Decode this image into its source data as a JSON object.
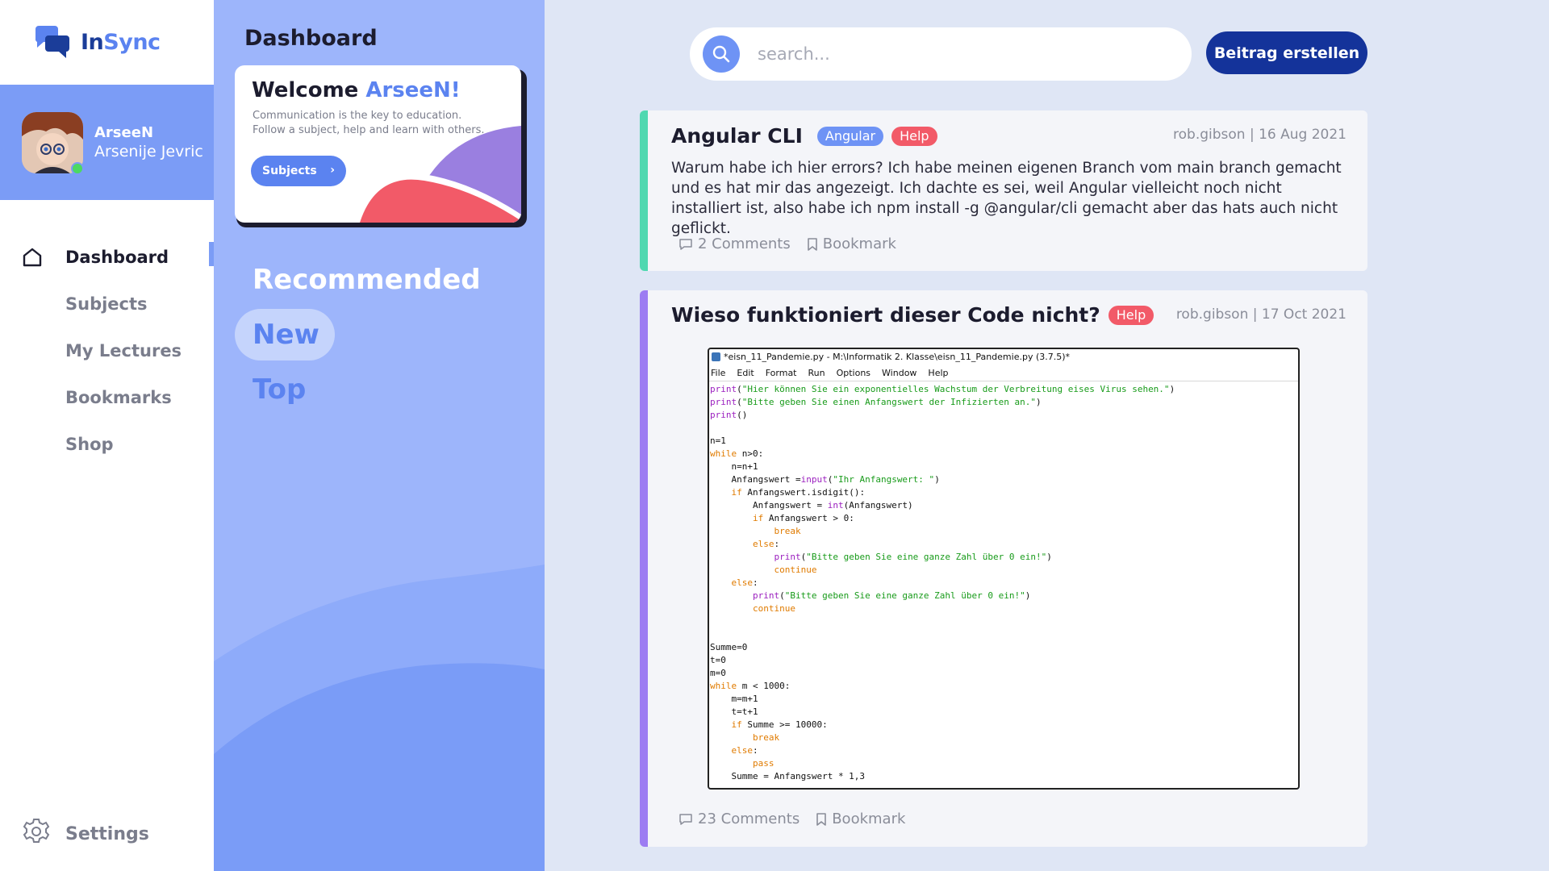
{
  "app": {
    "logo_part1": "In",
    "logo_part2": "Sync"
  },
  "profile": {
    "username": "ArseeN",
    "full_name": "Arsenije Jevric"
  },
  "nav": {
    "items": [
      {
        "label": "Dashboard"
      },
      {
        "label": "Subjects"
      },
      {
        "label": "My Lectures"
      },
      {
        "label": "Bookmarks"
      },
      {
        "label": "Shop"
      }
    ],
    "settings_label": "Settings"
  },
  "dashboard": {
    "title": "Dashboard",
    "welcome_prefix": "Welcome ",
    "welcome_name": "ArseeN!",
    "welcome_line1": "Communication is the key to education.",
    "welcome_line2": "Follow a subject, help and learn with others.",
    "subjects_button": "Subjects",
    "tabs": [
      {
        "label": "Recommended"
      },
      {
        "label": "New"
      },
      {
        "label": "Top"
      }
    ]
  },
  "search": {
    "placeholder": "search..."
  },
  "create_button": "Beitrag erstellen",
  "posts": [
    {
      "title": "Angular CLI",
      "tags": [
        "Angular",
        "Help"
      ],
      "meta": "rob.gibson | 16 Aug 2021",
      "body": "Warum habe ich hier errors? Ich habe meinen eigenen Branch vom main branch gemacht und es hat mir das angezeigt. Ich dachte es sei, weil Angular vielleicht noch nicht installiert ist, also habe ich npm install -g @angular/cli gemacht aber das hats auch nicht geflickt.",
      "comments": "2 Comments",
      "bookmark": "Bookmark",
      "accent": "#4fd8b0"
    },
    {
      "title": "Wieso funktioniert dieser Code nicht?",
      "tags": [
        "Help"
      ],
      "meta": "rob.gibson | 17 Oct 2021",
      "comments": "23 Comments",
      "bookmark": "Bookmark",
      "accent": "#9c7cf2",
      "code_window": {
        "title": "*eisn_11_Pandemie.py - M:\\Informatik 2. Klasse\\eisn_11_Pandemie.py (3.7.5)*",
        "menu": [
          "File",
          "Edit",
          "Format",
          "Run",
          "Options",
          "Window",
          "Help"
        ]
      }
    }
  ],
  "colors": {
    "primary": "#5b83f0",
    "dark_blue": "#14339a",
    "panel": "#9db5fb",
    "help_tag": "#f25a68"
  }
}
